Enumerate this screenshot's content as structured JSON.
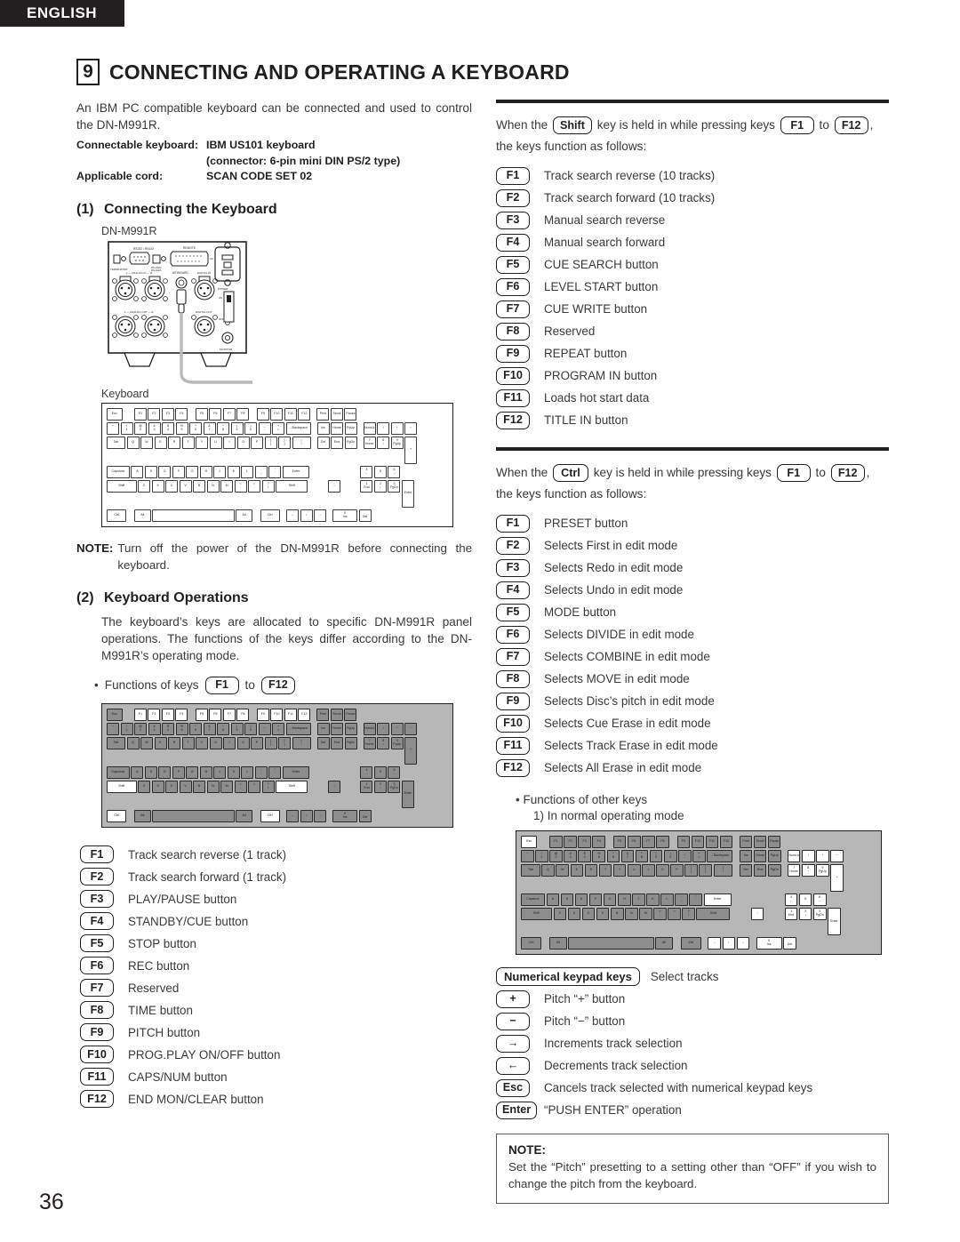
{
  "header": {
    "language": "ENGLISH"
  },
  "chapter": {
    "number": "9",
    "title": "CONNECTING AND OPERATING A KEYBOARD"
  },
  "intro": {
    "paragraph": "An IBM PC compatible keyboard can be connected and used to control the DN-M991R.",
    "specs": [
      {
        "key": "Connectable keyboard:",
        "value": "IBM US101 keyboard"
      },
      {
        "key": "",
        "value": "(connector: 6-pin mini DIN PS/2 type)"
      },
      {
        "key": "Applicable cord:",
        "value": "SCAN CODE SET 02"
      }
    ]
  },
  "section1": {
    "number": "(1)",
    "title": "Connecting the Keyboard",
    "device_label": "DN-M991R",
    "keyboard_label": "Keyboard",
    "note_label": "NOTE:",
    "note_text": "Turn off the power of the DN-M991R before connecting the keyboard."
  },
  "section2": {
    "number": "(2)",
    "title": "Keyboard Operations",
    "paragraph": "The keyboard’s keys are allocated to specific DN-M991R panel operations. The functions of the keys differ according to the DN-M991R’s operating mode.",
    "bullet_prefix": "Functions of keys",
    "bullet_key_from": "F1",
    "bullet_key_to": "F12",
    "bullet_sep": "to"
  },
  "normal_functions": [
    {
      "key": "F1",
      "desc": "Track search reverse (1 track)"
    },
    {
      "key": "F2",
      "desc": "Track search forward (1 track)"
    },
    {
      "key": "F3",
      "desc": "PLAY/PAUSE button"
    },
    {
      "key": "F4",
      "desc": "STANDBY/CUE button"
    },
    {
      "key": "F5",
      "desc": "STOP button"
    },
    {
      "key": "F6",
      "desc": "REC button"
    },
    {
      "key": "F7",
      "desc": "Reserved"
    },
    {
      "key": "F8",
      "desc": "TIME button"
    },
    {
      "key": "F9",
      "desc": "PITCH button"
    },
    {
      "key": "F10",
      "desc": "PROG.PLAY ON/OFF button"
    },
    {
      "key": "F11",
      "desc": "CAPS/NUM button"
    },
    {
      "key": "F12",
      "desc": "END MON/CLEAR button"
    }
  ],
  "shift_block": {
    "lead_1": "When the",
    "lead_key": "Shift",
    "lead_2": "key is held in while pressing keys",
    "key_from": "F1",
    "sep": "to",
    "key_to": "F12",
    "lead_3": ",",
    "lead_4": "the keys function as follows:",
    "functions": [
      {
        "key": "F1",
        "desc": "Track search reverse (10 tracks)"
      },
      {
        "key": "F2",
        "desc": "Track search forward (10 tracks)"
      },
      {
        "key": "F3",
        "desc": "Manual search reverse"
      },
      {
        "key": "F4",
        "desc": "Manual search forward"
      },
      {
        "key": "F5",
        "desc": "CUE SEARCH button"
      },
      {
        "key": "F6",
        "desc": "LEVEL START button"
      },
      {
        "key": "F7",
        "desc": "CUE WRITE button"
      },
      {
        "key": "F8",
        "desc": "Reserved"
      },
      {
        "key": "F9",
        "desc": "REPEAT button"
      },
      {
        "key": "F10",
        "desc": "PROGRAM IN button"
      },
      {
        "key": "F11",
        "desc": "Loads hot start data"
      },
      {
        "key": "F12",
        "desc": "TITLE IN button"
      }
    ]
  },
  "ctrl_block": {
    "lead_1": "When the",
    "lead_key": "Ctrl",
    "lead_2": "key is held in while pressing keys",
    "key_from": "F1",
    "sep": "to",
    "key_to": "F12",
    "lead_3": ",",
    "lead_4": "the keys function as follows:",
    "functions": [
      {
        "key": "F1",
        "desc": "PRESET button"
      },
      {
        "key": "F2",
        "desc": "Selects First in edit mode"
      },
      {
        "key": "F3",
        "desc": "Selects Redo in edit mode"
      },
      {
        "key": "F4",
        "desc": "Selects Undo in edit mode"
      },
      {
        "key": "F5",
        "desc": "MODE button"
      },
      {
        "key": "F6",
        "desc": "Selects DIVIDE in edit mode"
      },
      {
        "key": "F7",
        "desc": "Selects COMBINE in edit mode"
      },
      {
        "key": "F8",
        "desc": "Selects MOVE in edit mode"
      },
      {
        "key": "F9",
        "desc": "Selects Disc’s pitch in edit mode"
      },
      {
        "key": "F10",
        "desc": "Selects Cue Erase in edit mode"
      },
      {
        "key": "F11",
        "desc": "Selects Track Erase in edit mode"
      },
      {
        "key": "F12",
        "desc": "Selects All Erase in edit mode"
      }
    ]
  },
  "other_keys": {
    "bullet": "Functions of other keys",
    "sub": "1)  In normal operating mode",
    "rows": [
      {
        "key": "Numerical keypad keys",
        "desc": "Select tracks",
        "wide": true
      },
      {
        "key": "+",
        "desc": "Pitch “+” button"
      },
      {
        "key": "−",
        "desc": "Pitch “−” button"
      },
      {
        "key": "→",
        "desc": "Increments track selection"
      },
      {
        "key": "←",
        "desc": "Decrements track selection"
      },
      {
        "key": "Esc",
        "desc": "Cancels track selected with numerical keypad keys"
      },
      {
        "key": "Enter",
        "desc": "“PUSH ENTER” operation"
      }
    ]
  },
  "final_note": {
    "title": "NOTE:",
    "body": "Set the “Pitch” presetting to a setting other than “OFF” if you wish to change the pitch from the keyboard."
  },
  "page": {
    "number": "36"
  },
  "colors": {
    "ink": "#231f20",
    "body": "#3a3a3a",
    "shade": "#b7b7b7",
    "key_shade": "#8d8d8d"
  }
}
